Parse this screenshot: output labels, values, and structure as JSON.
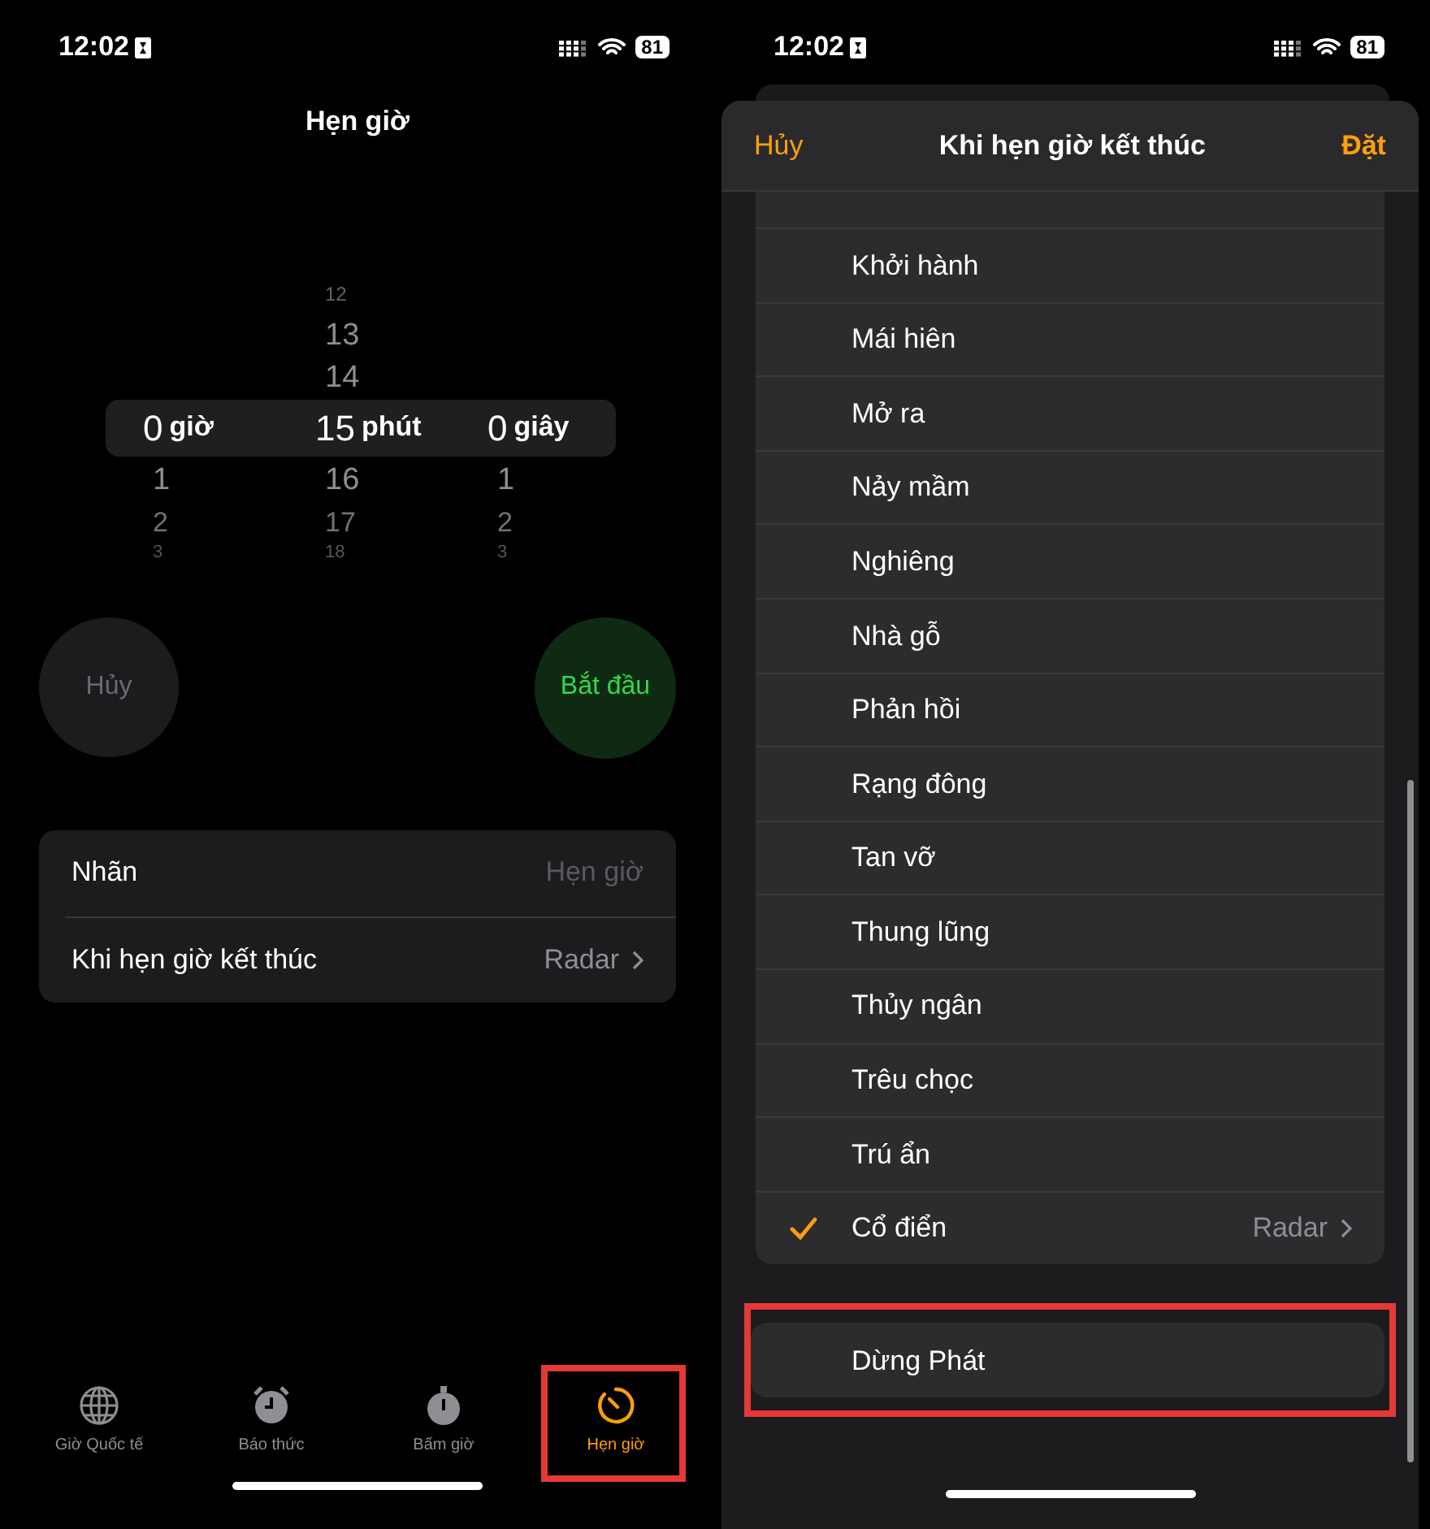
{
  "left_screen": {
    "status_bar": {
      "time": "12:02",
      "battery": "81"
    },
    "title": "Hẹn giờ",
    "picker": [
      {
        "unit": "giờ",
        "value": "0",
        "below": [
          "1",
          "2",
          "3"
        ]
      },
      {
        "unit": "phút",
        "value": "15",
        "above": [
          "12",
          "13",
          "14"
        ],
        "below": [
          "16",
          "17",
          "18"
        ]
      },
      {
        "unit": "giây",
        "value": "0",
        "below": [
          "1",
          "2",
          "3"
        ]
      }
    ],
    "cancel_button": "Hủy",
    "start_button": "Bắt đầu",
    "settings": [
      {
        "label": "Nhãn",
        "placeholder": "Hẹn giờ",
        "kind": "field"
      },
      {
        "label": "Khi hẹn giờ kết thúc",
        "value": "Radar",
        "kind": "link"
      }
    ],
    "tabs": [
      {
        "label": "Giờ Quốc tế",
        "kind": "globe",
        "selected": false,
        "highlighted": false
      },
      {
        "label": "Báo thức",
        "kind": "alarm",
        "selected": false,
        "highlighted": false
      },
      {
        "label": "Bấm giờ",
        "kind": "stopwatch",
        "selected": false,
        "highlighted": false
      },
      {
        "label": "Hẹn giờ",
        "kind": "timer",
        "selected": true,
        "highlighted": true
      }
    ]
  },
  "right_screen": {
    "status_bar": {
      "time": "12:02",
      "battery": "81"
    },
    "sheet": {
      "cancel": "Hủy",
      "title": "Khi hẹn giờ kết thúc",
      "confirm": "Đặt"
    },
    "sounds": [
      {
        "name": "Khởi hành",
        "selected": false
      },
      {
        "name": "Mái hiên",
        "selected": false
      },
      {
        "name": "Mở ra",
        "selected": false
      },
      {
        "name": "Nảy mầm",
        "selected": false
      },
      {
        "name": "Nghiêng",
        "selected": false
      },
      {
        "name": "Nhà gỗ",
        "selected": false
      },
      {
        "name": "Phản hồi",
        "selected": false
      },
      {
        "name": "Rạng đông",
        "selected": false
      },
      {
        "name": "Tan vỡ",
        "selected": false
      },
      {
        "name": "Thung lũng",
        "selected": false
      },
      {
        "name": "Thủy ngân",
        "selected": false
      },
      {
        "name": "Trêu chọc",
        "selected": false
      },
      {
        "name": "Trú ẩn",
        "selected": false
      },
      {
        "name": "Cổ điển",
        "selected": true,
        "detail": "Radar"
      }
    ],
    "stop_playing": {
      "label": "Dừng Phát",
      "highlighted": true
    }
  }
}
